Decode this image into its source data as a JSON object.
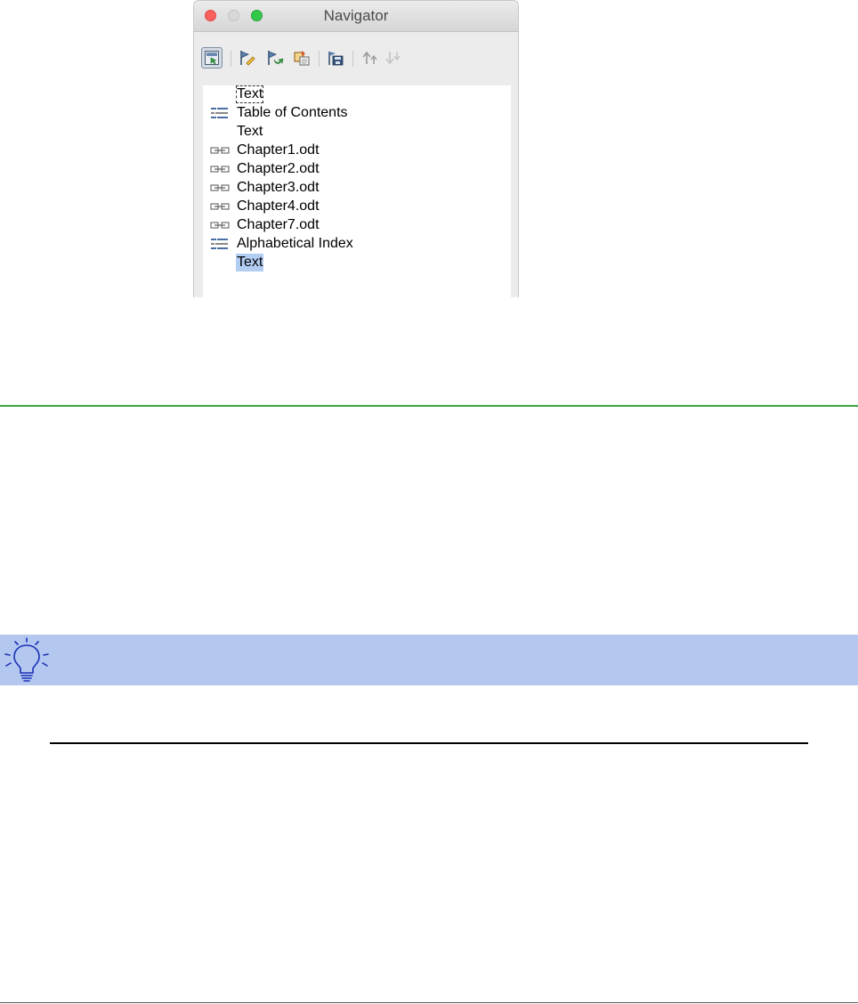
{
  "window": {
    "title": "Navigator"
  },
  "toolbar": {
    "buttons": [
      {
        "icon": "navigator-toggle-icon",
        "active": true
      },
      {
        "icon": "promote-chapter-icon"
      },
      {
        "icon": "demote-chapter-icon"
      },
      {
        "icon": "drag-mode-icon"
      },
      {
        "icon": "save-contents-icon"
      },
      {
        "icon": "move-up-icon",
        "disabled": true
      },
      {
        "icon": "move-down-icon",
        "disabled": true
      }
    ]
  },
  "list": {
    "items": [
      {
        "label": "Text",
        "type": "text",
        "state": "focused"
      },
      {
        "label": "Table of Contents",
        "type": "index"
      },
      {
        "label": "Text",
        "type": "text"
      },
      {
        "label": "Chapter1.odt",
        "type": "file"
      },
      {
        "label": "Chapter2.odt",
        "type": "file"
      },
      {
        "label": "Chapter3.odt",
        "type": "file"
      },
      {
        "label": "Chapter4.odt",
        "type": "file"
      },
      {
        "label": "Chapter7.odt",
        "type": "file"
      },
      {
        "label": "Alphabetical Index",
        "type": "index"
      },
      {
        "label": "Text",
        "type": "text",
        "state": "selected"
      }
    ]
  },
  "colors": {
    "selection": "#b2cdf2",
    "tip_band": "#b4c8ef",
    "heading_rule": "#3fa33f"
  }
}
